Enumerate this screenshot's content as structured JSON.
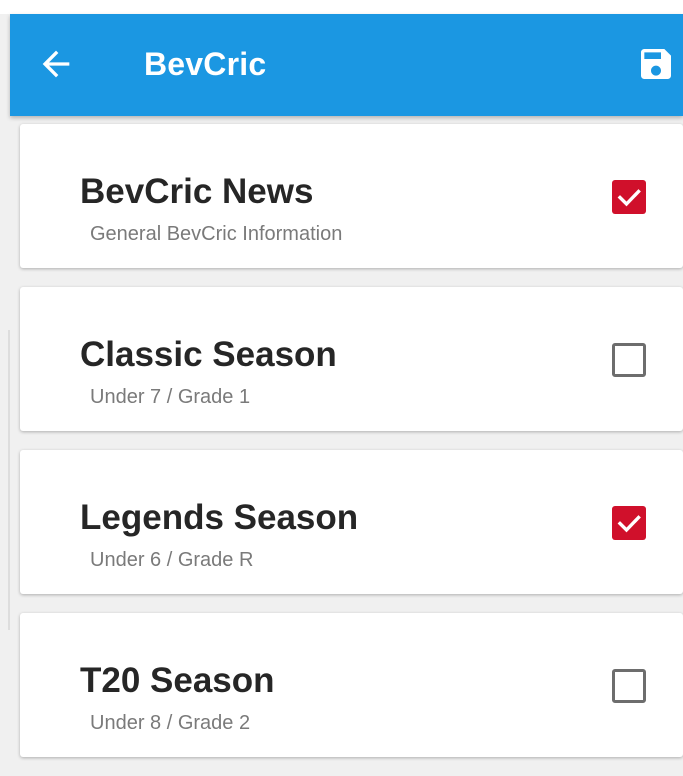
{
  "app_bar": {
    "title": "BevCric",
    "background_color": "#1b97e2",
    "back_icon": "arrow-left-icon",
    "save_icon": "floppy-disk-icon"
  },
  "list": {
    "accent_color": "#d0102b",
    "items": [
      {
        "title": "BevCric News",
        "subtitle": "General BevCric Information",
        "checked": true
      },
      {
        "title": "Classic Season",
        "subtitle": "Under 7 / Grade 1",
        "checked": false
      },
      {
        "title": "Legends Season",
        "subtitle": "Under 6 / Grade R",
        "checked": true
      },
      {
        "title": "T20 Season",
        "subtitle": "Under 8 / Grade 2",
        "checked": false
      }
    ]
  }
}
